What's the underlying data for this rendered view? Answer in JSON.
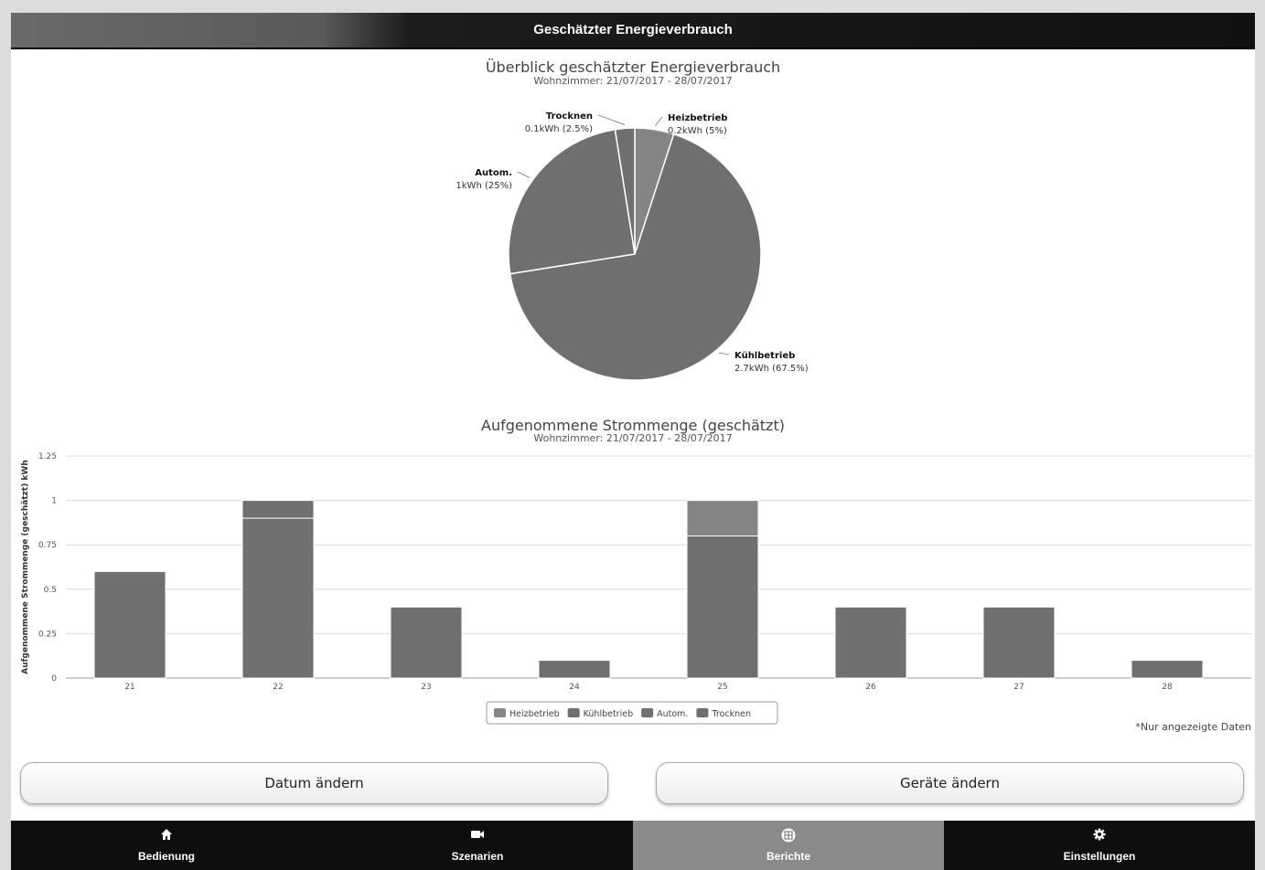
{
  "header": {
    "title": "Geschätzter Energieverbrauch"
  },
  "colors": {
    "slice": "#6f6f6f",
    "slice_light": "#858585",
    "grid": "#dcdcdc"
  },
  "pie": {
    "title": "Überblick geschätzter Energieverbrauch",
    "subtitle": "Wohnzimmer: 21/07/2017 - 28/07/2017"
  },
  "bar": {
    "title": "Aufgenommene Strommenge (geschätzt)",
    "subtitle": "Wohnzimmer: 21/07/2017 - 28/07/2017"
  },
  "chart_data": [
    {
      "type": "pie",
      "title": "Überblick geschätzter Energieverbrauch",
      "subtitle": "Wohnzimmer: 21/07/2017 - 28/07/2017",
      "slices": [
        {
          "name": "Heizbetrieb",
          "value": 0.2,
          "percent": 5,
          "label": "0.2kWh (5%)"
        },
        {
          "name": "Kühlbetrieb",
          "value": 2.7,
          "percent": 67.5,
          "label": "2.7kWh (67.5%)"
        },
        {
          "name": "Autom.",
          "value": 1,
          "percent": 25,
          "label": "1kWh (25%)"
        },
        {
          "name": "Trocknen",
          "value": 0.1,
          "percent": 2.5,
          "label": "0.1kWh (2.5%)"
        }
      ]
    },
    {
      "type": "bar",
      "stacked": true,
      "title": "Aufgenommene Strommenge (geschätzt)",
      "subtitle": "Wohnzimmer: 21/07/2017 - 28/07/2017",
      "ylabel": "Aufgenommene Strommenge (geschätzt) kWh",
      "xlabel": "",
      "ylim": [
        0,
        1.25
      ],
      "yticks": [
        "0",
        "0.25",
        "0.5",
        "0.75",
        "1",
        "1.25"
      ],
      "categories": [
        "21",
        "22",
        "23",
        "24",
        "25",
        "26",
        "27",
        "28"
      ],
      "series": [
        {
          "name": "Heizbetrieb",
          "values": [
            0,
            0,
            0,
            0,
            0.2,
            0,
            0,
            0
          ]
        },
        {
          "name": "Kühlbetrieb",
          "values": [
            0.6,
            0.9,
            0.4,
            0,
            0.8,
            0.4,
            0.4,
            0
          ]
        },
        {
          "name": "Autom.",
          "values": [
            0,
            0.1,
            0,
            0,
            0,
            0,
            0,
            0
          ]
        },
        {
          "name": "Trocknen",
          "values": [
            0,
            0,
            0,
            0.1,
            0,
            0,
            0,
            0.1
          ]
        }
      ],
      "legend": "bottom-center",
      "grid": true
    }
  ],
  "note": "*Nur angezeigte Daten",
  "buttons": {
    "date": "Datum ändern",
    "devices": "Geräte ändern"
  },
  "tabs": [
    {
      "label": "Bedienung",
      "icon": "home-icon",
      "active": false
    },
    {
      "label": "Szenarien",
      "icon": "camera-icon",
      "active": false
    },
    {
      "label": "Berichte",
      "icon": "table-icon",
      "active": true
    },
    {
      "label": "Einstellungen",
      "icon": "gear-icon",
      "active": false
    }
  ]
}
